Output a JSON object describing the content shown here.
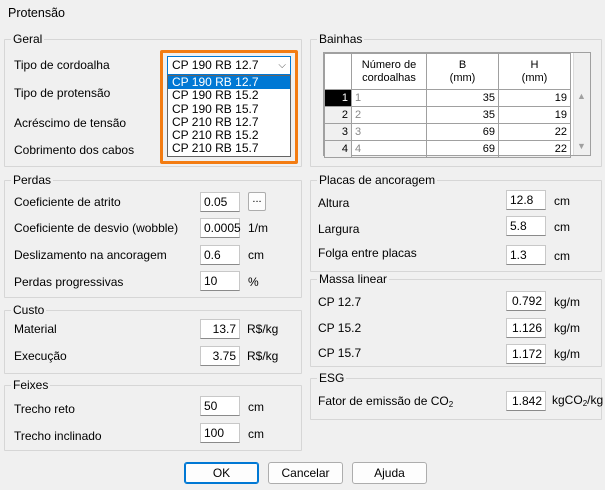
{
  "window": {
    "title": "Protensão"
  },
  "geral": {
    "title": "Geral",
    "labels": [
      "Tipo de cordoalha",
      "Tipo de protensão",
      "Acréscimo de tensão",
      "Cobrimento dos cabos"
    ],
    "combo_value": "CP 190 RB 12.7",
    "options": [
      "CP 190 RB 12.7",
      "CP 190 RB 15.2",
      "CP 190 RB 15.7",
      "CP 210 RB 12.7",
      "CP 210 RB 15.2",
      "CP 210 RB 15.7"
    ],
    "selected_option": "CP 190 RB 12.7"
  },
  "perdas": {
    "title": "Perdas",
    "atrito_label": "Coeficiente de atrito",
    "atrito_value": "0.05",
    "dots": "...",
    "desvio_label": "Coeficiente de desvio (wobble)",
    "desvio_value": "0.0005",
    "desvio_unit": "1/m",
    "desliz_label": "Deslizamento na ancoragem",
    "desliz_value": "0.6",
    "desliz_unit": "cm",
    "progr_label": "Perdas progressivas",
    "progr_value": "10",
    "progr_unit": "%"
  },
  "custo": {
    "title": "Custo",
    "material_label": "Material",
    "material_value": "13.7",
    "material_unit": "R$/kg",
    "execucao_label": "Execução",
    "execucao_value": "3.75",
    "execucao_unit": "R$/kg"
  },
  "feixes": {
    "title": "Feixes",
    "reto_label": "Trecho reto",
    "reto_value": "50",
    "reto_unit": "cm",
    "incl_label": "Trecho inclinado",
    "incl_value": "100",
    "incl_unit": "cm"
  },
  "bainhas": {
    "title": "Bainhas",
    "headers": {
      "n": "Número de cordoalhas",
      "b": "B\n(mm)",
      "h": "H\n(mm)"
    },
    "header_n1": "Número de",
    "header_n2": "cordoalhas",
    "header_b1": "B",
    "header_b2": "(mm)",
    "header_h1": "H",
    "header_h2": "(mm)",
    "rows": [
      {
        "idx": "1",
        "n": "1",
        "b": "35",
        "h": "19"
      },
      {
        "idx": "2",
        "n": "2",
        "b": "35",
        "h": "19"
      },
      {
        "idx": "3",
        "n": "3",
        "b": "69",
        "h": "22"
      },
      {
        "idx": "4",
        "n": "4",
        "b": "69",
        "h": "22"
      }
    ]
  },
  "placas": {
    "title": "Placas de ancoragem",
    "altura_label": "Altura",
    "altura_value": "12.8",
    "altura_unit": "cm",
    "largura_label": "Largura",
    "largura_value": "5.8",
    "largura_unit": "cm",
    "folga_label": "Folga entre placas",
    "folga_value": "1.3",
    "folga_unit": "cm"
  },
  "massa": {
    "title": "Massa linear",
    "cp127_label": "CP 12.7",
    "cp127_value": "0.792",
    "cp127_unit": "kg/m",
    "cp152_label": "CP 15.2",
    "cp152_value": "1.126",
    "cp152_unit": "kg/m",
    "cp157_label": "CP 15.7",
    "cp157_value": "1.172",
    "cp157_unit": "kg/m"
  },
  "esg": {
    "title": "ESG",
    "fator_label": "Fator de emissão de CO",
    "fator_sub": "2",
    "fator_value": "1.842",
    "fator_unit_a": "kgCO",
    "fator_unit_sub": "2",
    "fator_unit_b": "/kg"
  },
  "buttons": {
    "ok": "OK",
    "cancel": "Cancelar",
    "help": "Ajuda"
  },
  "colors": {
    "highlight": "#f37c12",
    "selection": "#0078d4"
  }
}
